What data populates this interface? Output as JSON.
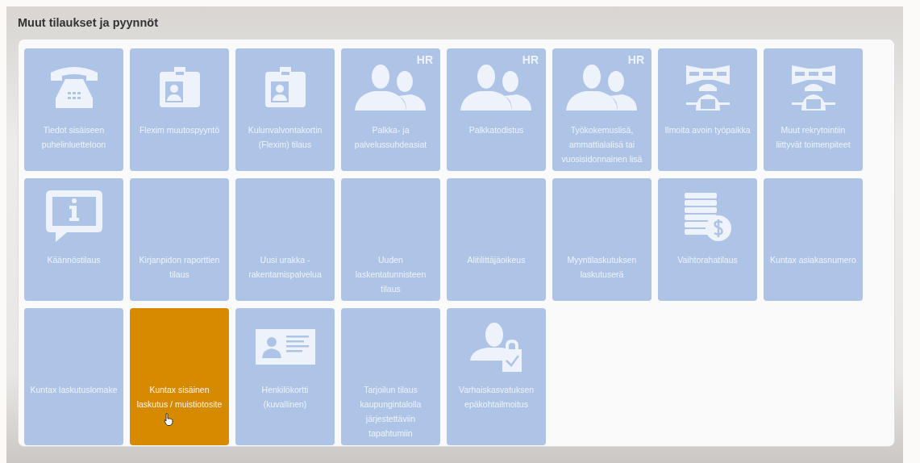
{
  "title": "Muut tilaukset ja pyynnöt",
  "tiles": [
    {
      "label": "Tiedot sisäiseen puhelinluetteloon",
      "kind": "phone",
      "selected": false
    },
    {
      "label": "Flexim muutospyyntö",
      "kind": "badge",
      "selected": false
    },
    {
      "label": "Kulunvalvontakortin (Flexim) tilaus",
      "kind": "badge",
      "selected": false
    },
    {
      "label": "Palkka- ja palvelussuhdeasiat",
      "kind": "people",
      "tag": "HR",
      "selected": false
    },
    {
      "label": "Palkkatodistus",
      "kind": "people",
      "tag": "HR",
      "selected": false
    },
    {
      "label": "Työkokemuslisä, ammattialalisä tai vuosisidonnainen lisä",
      "kind": "people",
      "tag": "HR",
      "selected": false
    },
    {
      "label": "Ilmoita avoin työpaikka",
      "kind": "worker",
      "selected": false
    },
    {
      "label": "Muut rekrytointiin liittyvät toimenpiteet",
      "kind": "worker",
      "selected": false
    },
    {
      "label": "Käännöstilaus",
      "kind": "info",
      "selected": false
    },
    {
      "label": "Kirjanpidon raporttien tilaus",
      "kind": "plain",
      "selected": false
    },
    {
      "label": "Uusi urakka - rakentamispalvelua",
      "kind": "plain",
      "selected": false
    },
    {
      "label": "Uuden laskentatunnisteen tilaus",
      "kind": "plain",
      "selected": false
    },
    {
      "label": "Alitilittäjäoikeus",
      "kind": "plain",
      "selected": false
    },
    {
      "label": "Myyntilaskutuksen laskutuserä",
      "kind": "plain",
      "selected": false
    },
    {
      "label": "Vaihtorahatilaus",
      "kind": "coins",
      "selected": false
    },
    {
      "label": "Kuntax asiakasnumero",
      "kind": "plain",
      "selected": false
    },
    {
      "label": "Kuntax laskutuslomake",
      "kind": "plain",
      "selected": false
    },
    {
      "label": "Kuntax sisäinen laskutus / muistiotosite",
      "kind": "plain",
      "selected": true
    },
    {
      "label": "Henkilökortti (kuvallinen)",
      "kind": "idcard",
      "selected": false
    },
    {
      "label": "Tarjoilun tilaus kaupungintalolla järjestettäviin tapahtumiin",
      "kind": "plain",
      "selected": false
    },
    {
      "label": "Varhaiskasvatuksen epäkohtailmoitus",
      "kind": "userlock",
      "selected": false
    }
  ]
}
